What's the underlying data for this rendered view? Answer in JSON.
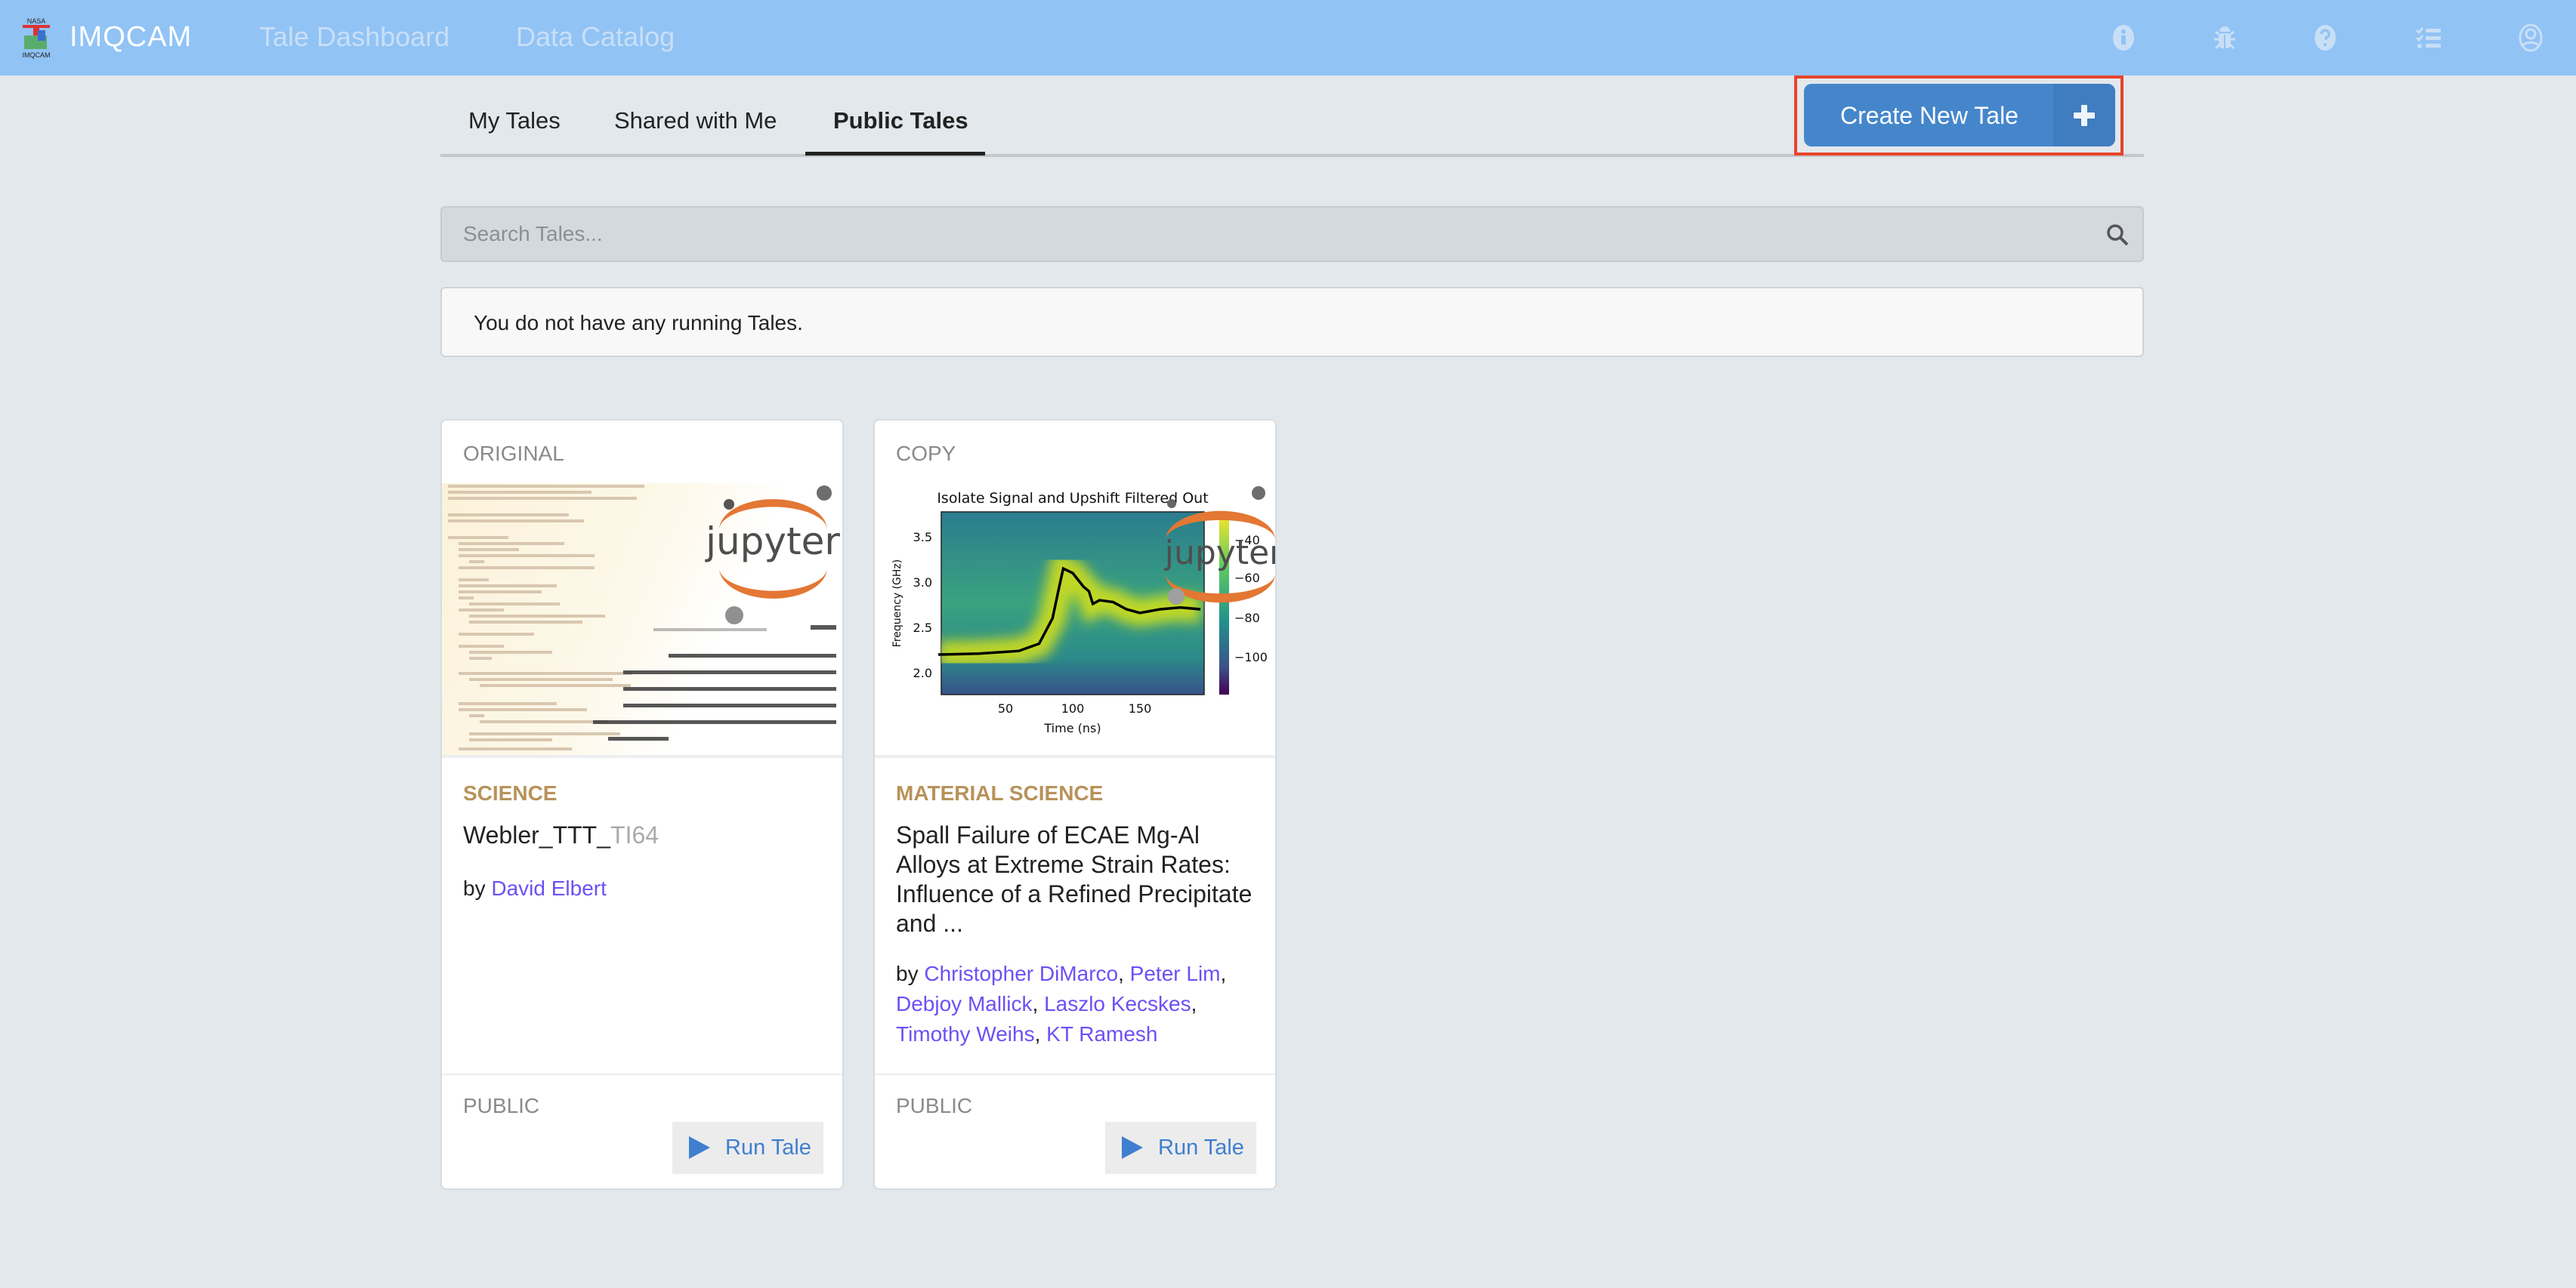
{
  "header": {
    "logo_text": [
      "NASA",
      "IMQCAM"
    ],
    "brand": "IMQCAM",
    "nav": [
      "Tale Dashboard",
      "Data Catalog"
    ],
    "icons": [
      "info-icon",
      "bug-icon",
      "help-icon",
      "tasks-icon",
      "user-icon"
    ],
    "bg_color": "#91c3f5"
  },
  "tabs": [
    {
      "label": "My Tales",
      "active": false
    },
    {
      "label": "Shared with Me",
      "active": false
    },
    {
      "label": "Public Tales",
      "active": true
    }
  ],
  "create_button": {
    "label": "Create New Tale",
    "icon": "plus-icon",
    "color": "#4586cb",
    "highlight_color": "#e8442a"
  },
  "search": {
    "placeholder": "Search Tales...",
    "value": "",
    "icon": "search-icon"
  },
  "notice": "You do not have any running Tales.",
  "cards": [
    {
      "kind": "ORIGINAL",
      "category": "SCIENCE",
      "title_main": "Webler_TTT_",
      "title_fade": "TI64",
      "by": "by",
      "authors": [
        "David Elbert"
      ],
      "visibility": "PUBLIC",
      "run_label": "Run Tale",
      "thumbnail_logo": "jupyter"
    },
    {
      "kind": "COPY",
      "category": "MATERIAL SCIENCE",
      "title_main": "Spall Failure of ECAE Mg-Al Alloys at Extreme Strain Rates: Influence of a Refined Precipitate and ...",
      "title_fade": "",
      "by": "by",
      "authors": [
        "Christopher DiMarco",
        "Peter Lim",
        "Debjoy Mallick",
        "Laszlo Kecskes",
        "Timothy Weihs",
        "KT Ramesh"
      ],
      "visibility": "PUBLIC",
      "run_label": "Run Tale",
      "thumbnail_logo": "jupyter",
      "thumbnail_plot": {
        "title": "Isolate Signal and Upshift Filtered Out",
        "xlabel": "Time (ns)",
        "ylabel": "Frequency (GHz)",
        "xticks": [
          "50",
          "100",
          "150"
        ],
        "yticks": [
          "3.5",
          "3.0",
          "2.5",
          "2.0"
        ],
        "colorbar_ticks": [
          "−40",
          "−60",
          "−80",
          "−100"
        ],
        "line": {
          "t": [
            0,
            30,
            60,
            75,
            85,
            90,
            93,
            100,
            108,
            112,
            115,
            120,
            130,
            140,
            150,
            165,
            180,
            195
          ],
          "f": [
            2.2,
            2.21,
            2.24,
            2.32,
            2.6,
            2.95,
            3.15,
            3.1,
            2.95,
            2.9,
            2.76,
            2.8,
            2.78,
            2.7,
            2.66,
            2.7,
            2.72,
            2.7
          ]
        }
      }
    }
  ]
}
